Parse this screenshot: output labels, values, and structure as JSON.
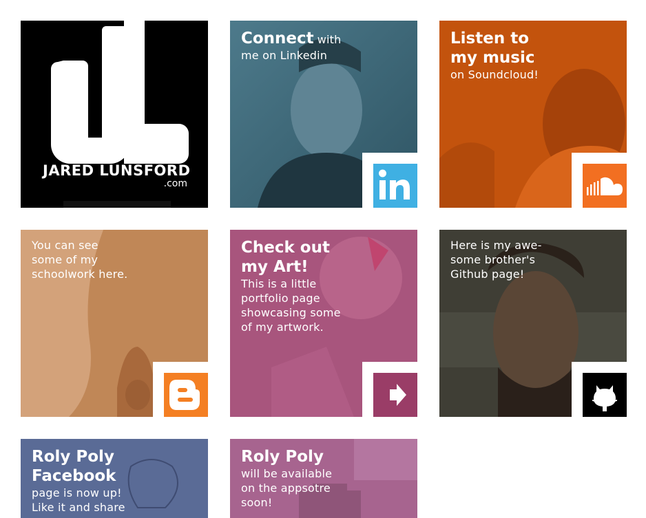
{
  "tiles": {
    "logo": {
      "name_text": "JARED LUNSFORD",
      "domain_text": ".com",
      "logo_letters": "JL"
    },
    "linkedin": {
      "headline": "Connect",
      "sub": "with\nme on Linkedin",
      "badge_icon": "linkedin-icon",
      "badge_text": "in",
      "badge_color": "#3fb0e3",
      "overlay_color": "#3e6b7c"
    },
    "soundcloud": {
      "headline": "Listen to\nmy music",
      "sub": "on Soundcloud!",
      "badge_icon": "soundcloud-icon",
      "badge_color": "#f26f21",
      "overlay_color": "#c3530d"
    },
    "blogger": {
      "sub": "You can see\nsome of my\nschoolwork here.",
      "badge_icon": "blogger-icon",
      "badge_color": "#f47f23",
      "overlay_color": "#c08757"
    },
    "art": {
      "headline": "Check out\nmy Art!",
      "sub": "This is a little\nportfolio page\nshowcasing some\nof my artwork.",
      "badge_icon": "arrow-right-icon",
      "badge_color": "#9a3d67",
      "overlay_color": "#a8557d"
    },
    "github": {
      "sub": "Here is my awe-\nsome brother's\nGithub page!",
      "badge_icon": "github-icon",
      "badge_color": "#000000"
    },
    "facebook": {
      "headline": "Roly Poly\nFacebook",
      "sub": "page is now up!\nLike it and share",
      "overlay_color": "#5a6b96"
    },
    "app": {
      "headline": "Roly Poly",
      "sub": "will be available\non the appsotre\nsoon!",
      "overlay_color": "#a7648f"
    }
  }
}
